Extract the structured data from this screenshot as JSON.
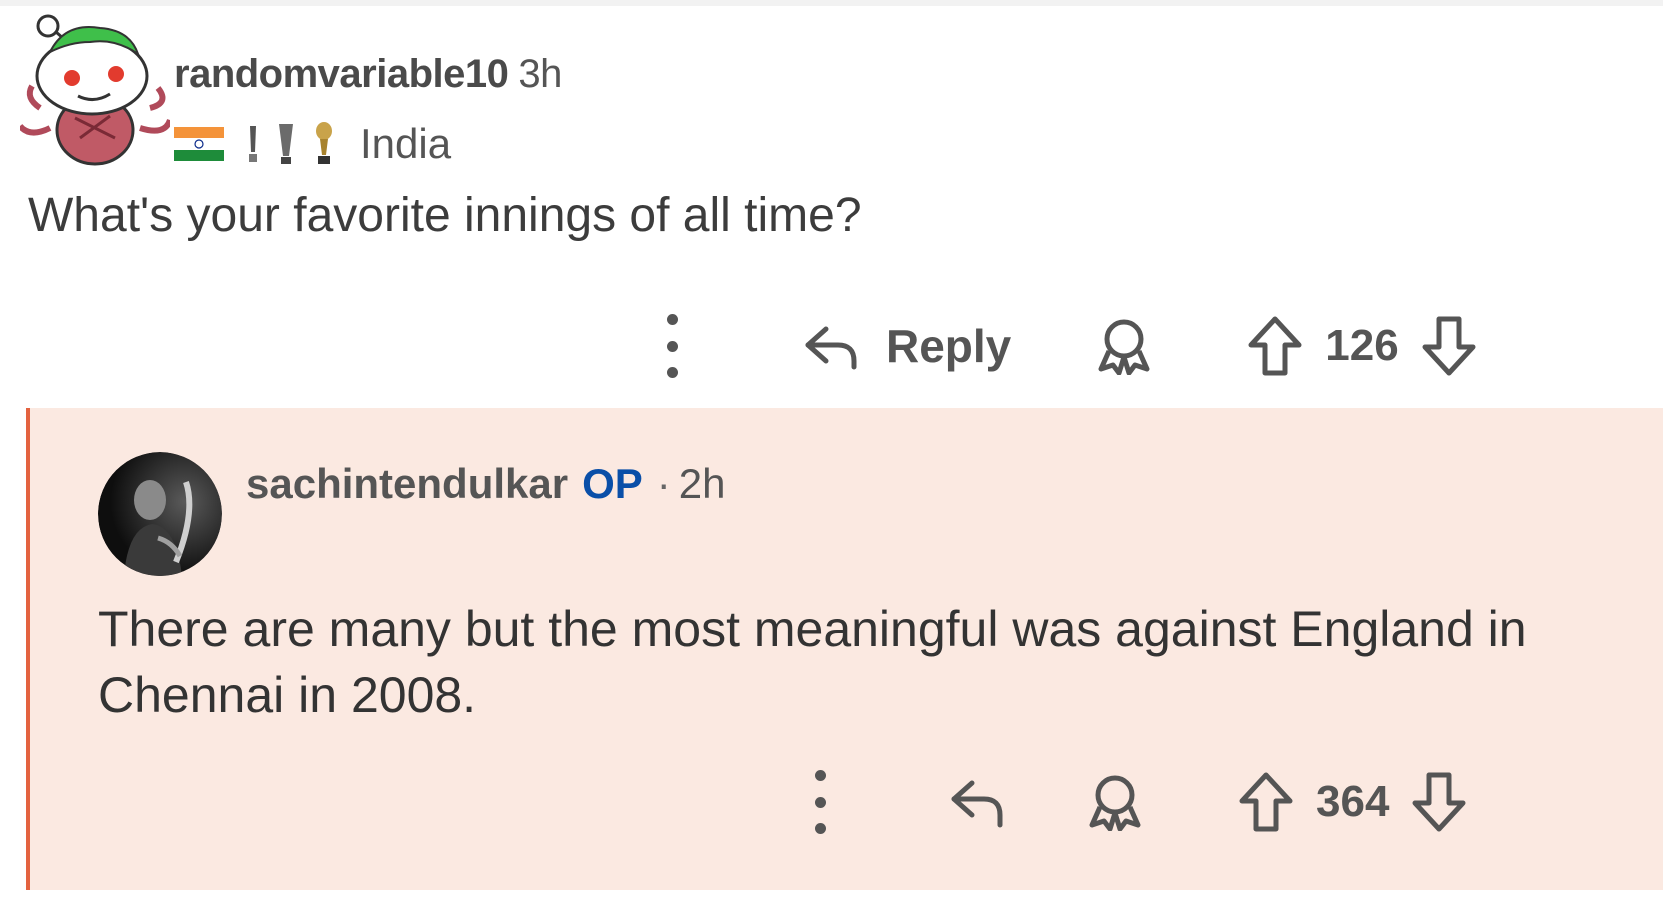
{
  "parent_comment": {
    "username": "randomvariable10",
    "time": "3h",
    "flair_text": "India",
    "body": "What's your favorite innings of all time?",
    "reply_label": "Reply",
    "vote_count": "126"
  },
  "child_comment": {
    "username": "sachintendulkar",
    "op_badge": "OP",
    "separator": "·",
    "time": "2h",
    "body": "There are many but the most meaningful was against England in Chennai in 2008.",
    "vote_count": "364"
  },
  "colors": {
    "op_badge": "#0a4fa8",
    "reply_highlight_bg": "#fbe9e1",
    "reply_highlight_border": "#e3623f",
    "text": "#555555"
  },
  "icons": {
    "more": "more-vertical-icon",
    "reply": "reply-arrow-icon",
    "award": "award-icon",
    "upvote": "upvote-arrow-icon",
    "downvote": "downvote-arrow-icon",
    "flag": "india-flag-icon",
    "trophy": "trophy-icon"
  }
}
